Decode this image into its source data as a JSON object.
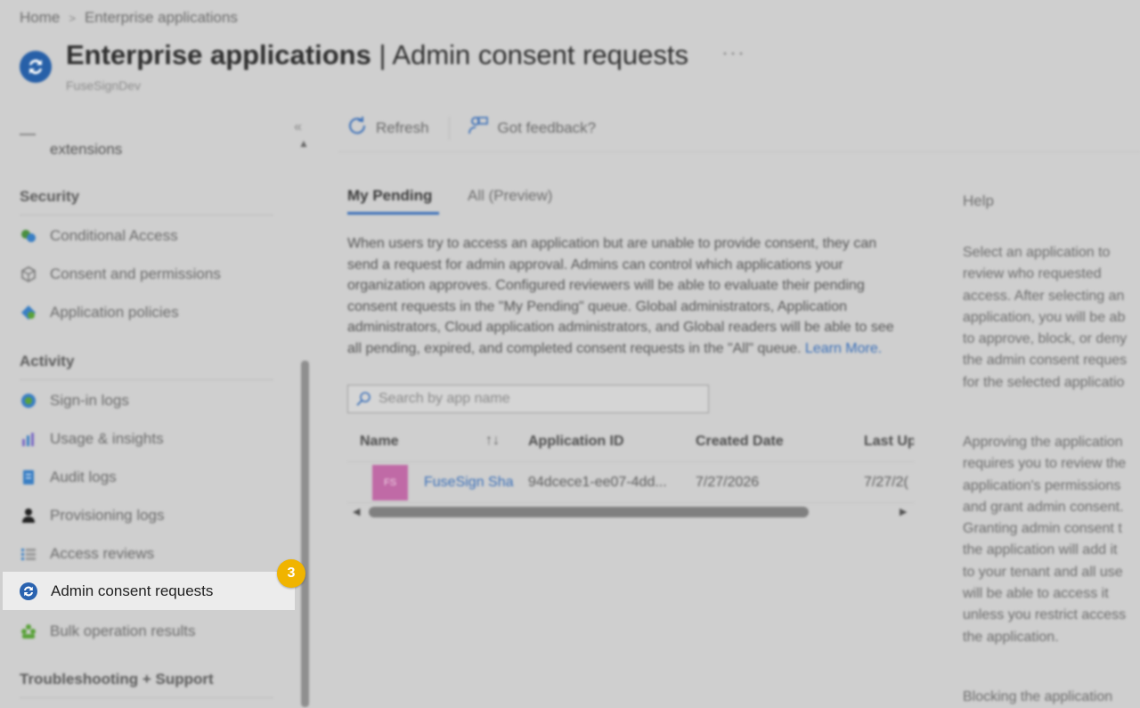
{
  "breadcrumb": {
    "home": "Home",
    "current": "Enterprise applications"
  },
  "header": {
    "title_bold": "Enterprise applications",
    "title_rest": " | Admin consent requests",
    "tenant": "FuseSignDev",
    "more_icon": "ellipsis-icon"
  },
  "sidebar": {
    "partial_item": "extensions",
    "security": {
      "heading": "Security",
      "items": [
        "Conditional Access",
        "Consent and permissions",
        "Application policies"
      ]
    },
    "activity": {
      "heading": "Activity",
      "items": [
        "Sign-in logs",
        "Usage & insights",
        "Audit logs",
        "Provisioning logs",
        "Access reviews",
        "Admin consent requests",
        "Bulk operation results"
      ]
    },
    "troubleshooting": {
      "heading": "Troubleshooting + Support"
    },
    "highlight_step": "3"
  },
  "toolbar": {
    "refresh": "Refresh",
    "feedback": "Got feedback?"
  },
  "tabs": {
    "active": "My Pending",
    "other": "All (Preview)"
  },
  "description": {
    "text": "When users try to access an application but are unable to provide consent, they can send a request for admin approval. Admins can control which applications your organization approves. Configured reviewers will be able to evaluate their pending consent requests in the \"My Pending\" queue. Global administrators, Application administrators, Cloud application administrators, and Global readers will be able to see all pending, expired, and completed consent requests in the \"All\" queue.",
    "link": "Learn More."
  },
  "search": {
    "placeholder": "Search by app name"
  },
  "table": {
    "headers": {
      "name": "Name",
      "app_id": "Application ID",
      "created": "Created Date",
      "last": "Last Up"
    },
    "rows": [
      {
        "initials": "FS",
        "name": "FuseSign Sha",
        "app_id": "94dcece1-ee07-4dd...",
        "created": "7/27/2026",
        "last": "7/27/2("
      }
    ]
  },
  "help": {
    "title": "Help",
    "p1": "Select an application to\nreview who requested\naccess. After selecting an\napplication, you will be ab\nto approve, block, or deny\nthe admin consent reques\nfor the selected applicatio",
    "p2": "Approving the application\nrequires you to review the\napplication's permissions\nand grant admin consent.\nGranting admin consent t\nthe application will add it\nto your tenant and all use\nwill be able to access it\nunless you restrict access\nthe application.",
    "p3": "Blocking the application"
  },
  "colors": {
    "accent": "#3a6fb8",
    "badge": "#f0b400",
    "app_tile": "#c06aa6"
  }
}
